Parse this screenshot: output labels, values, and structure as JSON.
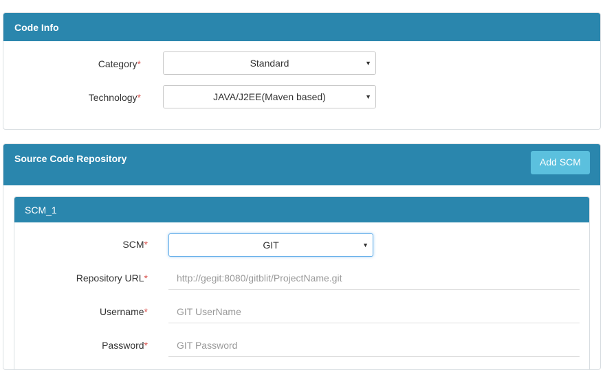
{
  "code_info": {
    "title": "Code Info",
    "category": {
      "label": "Category",
      "required_mark": "*",
      "value": "Standard"
    },
    "technology": {
      "label": "Technology",
      "required_mark": "*",
      "value": "JAVA/J2EE(Maven based)"
    }
  },
  "source_repo": {
    "title": "Source Code Repository",
    "add_button_label": "Add SCM",
    "scm_panel": {
      "title": "SCM_1",
      "scm": {
        "label": "SCM",
        "required_mark": "*",
        "value": "GIT"
      },
      "repository_url": {
        "label": "Repository URL",
        "required_mark": "*",
        "placeholder": "http://gegit:8080/gitblit/ProjectName.git"
      },
      "username": {
        "label": "Username",
        "required_mark": "*",
        "placeholder": "GIT UserName"
      },
      "password": {
        "label": "Password",
        "required_mark": "*",
        "placeholder": "GIT Password"
      }
    }
  },
  "colors": {
    "header_bg": "#2a86ad",
    "add_button_bg": "#5bc0de",
    "required": "#d9534f"
  },
  "icons": {
    "dropdown": "caret-down-icon"
  }
}
